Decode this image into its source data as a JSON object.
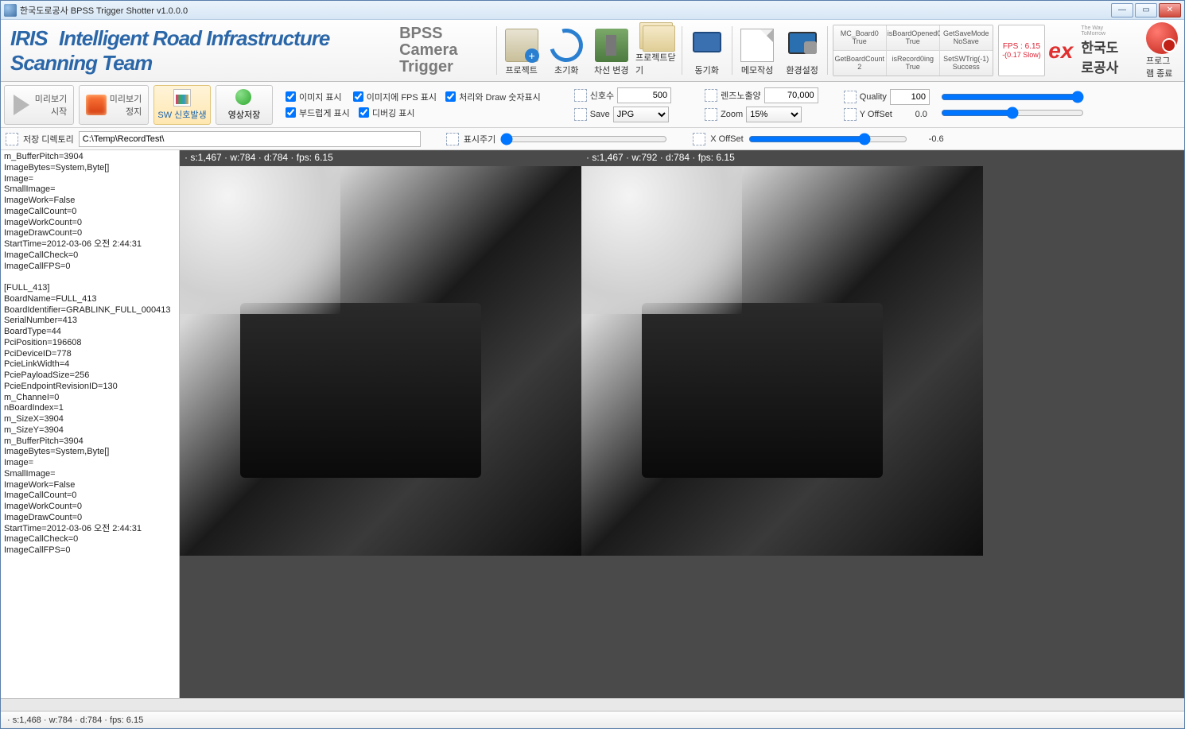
{
  "window": {
    "title": "한국도로공사 BPSS Trigger Shotter v1.0.0.0"
  },
  "logo": {
    "iris": "IRIS",
    "iris_sub": "Intelligent Road\nInfrastructure Scanning Team",
    "title_line1": "BPSS Camera",
    "title_line2": "Trigger"
  },
  "toolbar": {
    "project": "프로젝트",
    "init": "초기화",
    "lane_change": "차선 변경",
    "project_close": "프로젝트닫기",
    "sync": "동기화",
    "memo": "메모작성",
    "env": "환경설정",
    "prog_end": "프로그램 종료"
  },
  "status": {
    "r1c1_k": "MC_Board0",
    "r1c1_v": "True",
    "r1c2_k": "isBoardOpened0",
    "r1c2_v": "True",
    "r1c3_k": "GetSaveMode",
    "r1c3_v": "NoSave",
    "r2c1_k": "GetBoardCount",
    "r2c1_v": "2",
    "r2c2_k": "isRecord0ing",
    "r2c2_v": "True",
    "r2c3_k": "SetSWTrig(-1)",
    "r2c3_v": "Success"
  },
  "fps_box": {
    "main": "FPS : 6.15",
    "sub": "-(0.17 Slow)"
  },
  "brand": {
    "ex": "ex",
    "kr": "한국도로공사",
    "kr_sub": "The Way ToMorrow"
  },
  "preview": {
    "start": "미리보기\n시작",
    "stop": "미리보기\n정지",
    "sw_signal": "SW 신호발생",
    "save_video": "영상저장"
  },
  "checks": {
    "show_image": "이미지 표시",
    "fps_on_image": "이미지에 FPS 표시",
    "show_proc_num": "처리와 Draw 숫자표시",
    "smooth": "부드럽게 표시",
    "debug": "디버깅 표시"
  },
  "fields": {
    "signal_label": "신호수",
    "signal_value": "500",
    "save_label": "Save",
    "save_format": "JPG",
    "lens_label": "렌즈노출양",
    "lens_value": "70,000",
    "zoom_label": "Zoom",
    "zoom_value": "15%",
    "quality_label": "Quality",
    "quality_value": "100",
    "yoff_label": "Y OffSet",
    "yoff_value": "0.0",
    "xoff_label": "X OffSet",
    "xoff_value": "-0.6",
    "dir_label": "저장 디렉토리",
    "dir_value": "C:\\Temp\\RecordTest\\",
    "cycle_label": "표시주기"
  },
  "camera": {
    "left_overlay": "· s:1,467 · w:784 · d:784 · fps: 6.15",
    "right_overlay": "· s:1,467 · w:792 · d:784 · fps: 6.15"
  },
  "statusbar": "· s:1,468 · w:784 · d:784 · fps: 6.15",
  "log_text": "m_BufferPitch=3904\nImageBytes=System,Byte[]\nImage=\nSmallImage=\nImageWork=False\nImageCallCount=0\nImageWorkCount=0\nImageDrawCount=0\nStartTime=2012-03-06 오전 2:44:31\nImageCallCheck=0\nImageCallFPS=0\n\n[FULL_413]\nBoardName=FULL_413\nBoardIdentifier=GRABLINK_FULL_000413\nSerialNumber=413\nBoardType=44\nPciPosition=196608\nPciDeviceID=778\nPcieLinkWidth=4\nPciePayloadSize=256\nPcieEndpointRevisionID=130\nm_ChanneI=0\nnBoardIndex=1\nm_SizeX=3904\nm_SizeY=3904\nm_BufferPitch=3904\nImageBytes=System,Byte[]\nImage=\nSmallImage=\nImageWork=False\nImageCallCount=0\nImageWorkCount=0\nImageDrawCount=0\nStartTime=2012-03-06 오전 2:44:31\nImageCallCheck=0\nImageCallFPS=0"
}
